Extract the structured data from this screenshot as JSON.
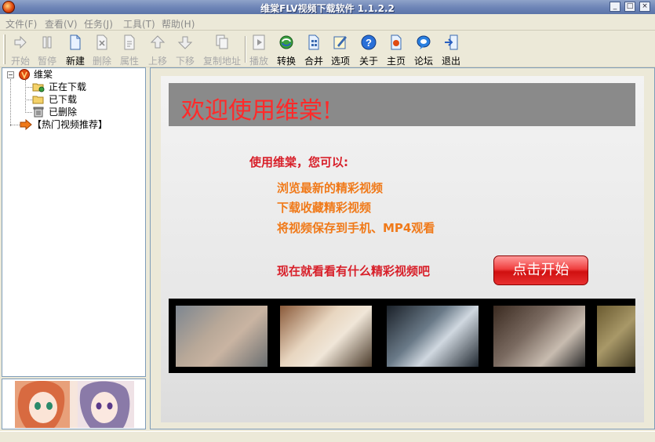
{
  "window": {
    "title": "维棠FLV视频下载软件 1.1.2.2",
    "controls": [
      "_",
      "□",
      "×"
    ]
  },
  "menu": [
    "文件(F)",
    "查看(V)",
    "任务(J)",
    "工具(T)",
    "帮助(H)"
  ],
  "toolbar": [
    {
      "label": "开始",
      "icon": "play-arrow-icon",
      "enabled": false
    },
    {
      "label": "暂停",
      "icon": "pause-icon",
      "enabled": false
    },
    {
      "label": "新建",
      "icon": "new-document-icon",
      "enabled": true
    },
    {
      "label": "删除",
      "icon": "delete-icon",
      "enabled": false
    },
    {
      "label": "属性",
      "icon": "properties-icon",
      "enabled": false
    },
    {
      "label": "上移",
      "icon": "move-up-icon",
      "enabled": false
    },
    {
      "label": "下移",
      "icon": "move-down-icon",
      "enabled": false
    },
    {
      "label": "复制地址",
      "icon": "copy-address-icon",
      "enabled": false
    },
    {
      "label": "播放",
      "icon": "play-media-icon",
      "enabled": false
    },
    {
      "label": "转换",
      "icon": "convert-icon",
      "enabled": true
    },
    {
      "label": "合并",
      "icon": "merge-icon",
      "enabled": true
    },
    {
      "label": "选项",
      "icon": "options-icon",
      "enabled": true
    },
    {
      "label": "关于",
      "icon": "about-icon",
      "enabled": true
    },
    {
      "label": "主页",
      "icon": "homepage-icon",
      "enabled": true
    },
    {
      "label": "论坛",
      "icon": "forum-icon",
      "enabled": true
    },
    {
      "label": "退出",
      "icon": "exit-icon",
      "enabled": true
    }
  ],
  "tree": {
    "root": "维棠",
    "children": [
      "正在下载",
      "已下载",
      "已删除"
    ],
    "recommend": "【热门视频推荐】"
  },
  "main": {
    "banner": "欢迎使用维棠!",
    "lead": "使用维棠，您可以:",
    "features": [
      "浏览最新的精彩视频",
      "下载收藏精彩视频",
      "将视频保存到手机、MP4观看"
    ],
    "cta": "现在就看看有什么精彩视频吧",
    "start_button": "点击开始"
  },
  "colors": {
    "title_bar": "#6f86b8",
    "banner_bg": "#8a8a8a",
    "banner_text": "#ff2a2a",
    "lead_text": "#d8202a",
    "feature_text": "#f07a1a",
    "start_button": "#e83030"
  }
}
